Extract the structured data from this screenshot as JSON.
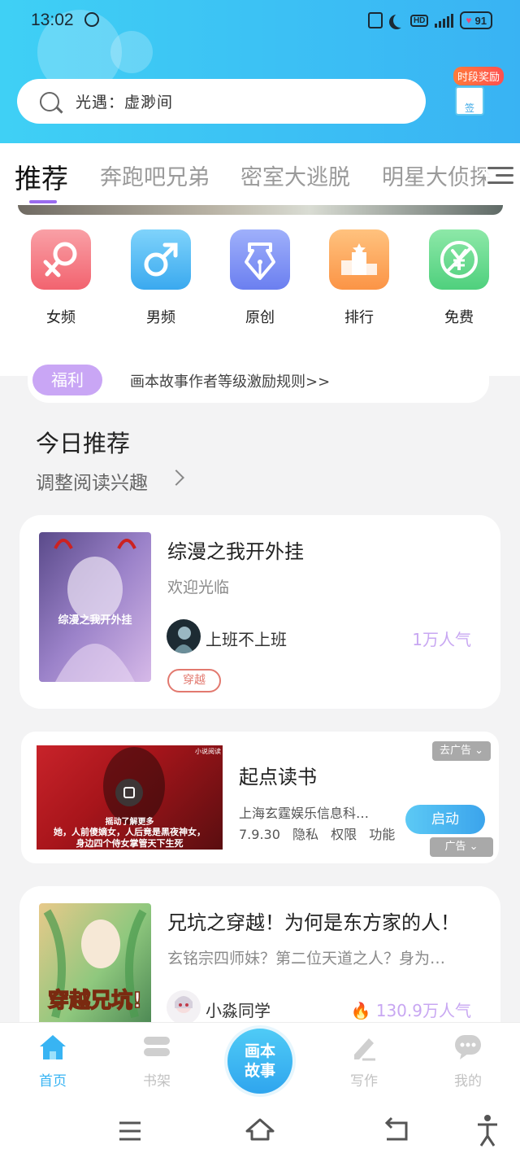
{
  "status_bar": {
    "time": "13:02",
    "battery": "91"
  },
  "search": {
    "placeholder": "光遇：虚渺间"
  },
  "reward": {
    "badge": "时段奖励",
    "box_label": "签"
  },
  "tabs": [
    {
      "label": "推荐",
      "active": true
    },
    {
      "label": "奔跑吧兄弟"
    },
    {
      "label": "密室大逃脱"
    },
    {
      "label": "明星大侦探"
    }
  ],
  "categories": [
    {
      "label": "女频",
      "icon": "female-icon",
      "color": "#f4707e"
    },
    {
      "label": "男频",
      "icon": "male-icon",
      "color": "#4bb9f2"
    },
    {
      "label": "原创",
      "icon": "pen-icon",
      "color": "#6d86f0"
    },
    {
      "label": "排行",
      "icon": "podium-icon",
      "color": "#fca55a"
    },
    {
      "label": "免费",
      "icon": "yuan-icon",
      "color": "#5fd98a"
    }
  ],
  "notice": {
    "tag": "福利",
    "text": "画本故事作者等级激励规则>>"
  },
  "today": {
    "title": "今日推荐",
    "subtitle": "调整阅读兴趣"
  },
  "books": [
    {
      "title": "综漫之我开外挂",
      "desc": "欢迎光临",
      "author": "上班不上班",
      "popularity": "1万人气",
      "tag": "穿越",
      "cover_text": "综漫之我开外挂"
    },
    {
      "title": "兄坑之穿越！为何是东方家的人！",
      "desc": "玄铭宗四师妹？第二位天道之人？身为…",
      "author": "小淼同学",
      "popularity": "130.9万人气",
      "cover_text": "穿越兄坑!"
    }
  ],
  "ad": {
    "title": "起点读书",
    "company": "上海玄霆娱乐信息科…",
    "version": "7.9.30",
    "privacy": "隐私",
    "permissions": "权限",
    "features": "功能",
    "button": "启动",
    "close_label": "去广告",
    "ad_label": "广告",
    "image_hint": "摇动了解更多",
    "caption_1": "她，人前傻嫡女，人后竟是黑夜神女，",
    "caption_2": "身边四个侍女掌管天下生死",
    "corner_tag": "小说阅读"
  },
  "bottom_nav": {
    "home": "首页",
    "shelf": "书架",
    "center": "画本故事",
    "center_line1": "画本",
    "center_line2": "故事",
    "write": "写作",
    "mine": "我的"
  },
  "colors": {
    "accent_blue": "#39b3f3",
    "accent_purple": "#9a6bef",
    "tag_purple": "#c9a6f5",
    "popularity_purple": "#c8a7f2",
    "genre_red": "#e2796f"
  }
}
